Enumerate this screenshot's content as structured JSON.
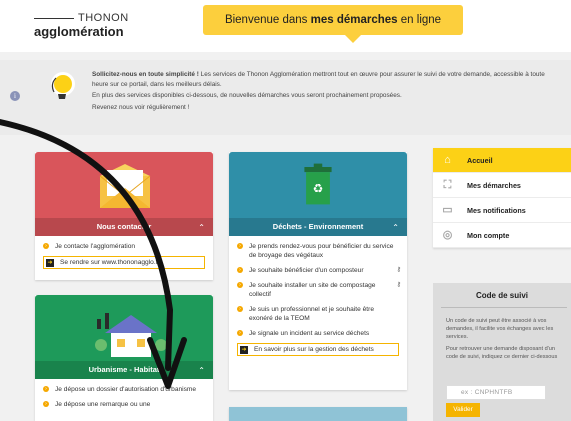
{
  "header": {
    "logo_top": "THONON",
    "logo_bottom": "agglomération",
    "banner_prefix": "Bienvenue dans ",
    "banner_bold": "mes démarches",
    "banner_suffix": " en ligne"
  },
  "info": {
    "icon": "info-icon",
    "bold": "Sollicitez-nous en toute simplicité !",
    "line1": " Les services de Thonon Agglomération mettront tout en œuvre pour assurer le suivi de votre demande, accessible à toute heure sur ce portail, dans les meilleurs délais.",
    "line2": "En plus des services disponibles ci-dessous, de nouvelles démarches vous seront prochainement proposées.",
    "line3": "Revenez nous voir régulièrement !"
  },
  "cards": {
    "contact": {
      "title": "Nous contacter",
      "items": [
        "Je contacte l'agglomération"
      ],
      "link": "Se rendre sur www.thononagglo.fr",
      "color": "#d9555b"
    },
    "dechets": {
      "title": "Déchets - Environnement",
      "items": [
        "Je prends rendez-vous pour bénéficier du service de broyage des végétaux",
        "Je souhaite bénéficier d'un composteur",
        "Je souhaite installer un site de compostage collectif",
        "Je suis un professionnel et je souhaite être exonéré de la TEOM",
        "Je signale un incident au service déchets"
      ],
      "link": "En savoir plus sur la gestion des déchets",
      "color": "#2f8fa8"
    },
    "urbanisme": {
      "title": "Urbanisme - Habitat",
      "items": [
        "Je dépose un dossier d'autorisation d'urbanisme",
        "Je dépose une remarque ou une"
      ],
      "color": "#1e9a5a"
    }
  },
  "nav": {
    "items": [
      {
        "label": "Accueil",
        "icon": "home-icon",
        "active": true
      },
      {
        "label": "Mes démarches",
        "icon": "grid-icon",
        "active": false
      },
      {
        "label": "Mes notifications",
        "icon": "chat-icon",
        "active": false
      },
      {
        "label": "Mon compte",
        "icon": "user-icon",
        "active": false
      }
    ]
  },
  "suivi": {
    "title": "Code de suivi",
    "text1": "Un code de suivi peut être associé à vos demandes, il facilite vos échanges avec les services.",
    "text2": "Pour retrouver une demande disposant d'un code de suivi, indiquez ce dernier ci-dessous",
    "placeholder": "ex : CNPHNTFB",
    "button": "Valider"
  },
  "colors": {
    "accent": "#fcd116",
    "frame": "#2e3a8c"
  }
}
